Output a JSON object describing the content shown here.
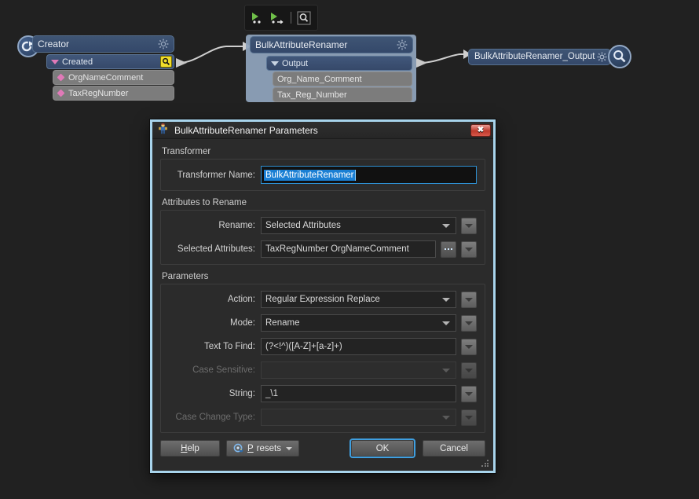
{
  "canvas": {
    "toolbar": {
      "buttons": [
        {
          "name": "run-to-this-icon",
          "label": "run-to-this"
        },
        {
          "name": "run-from-this-icon",
          "label": "run-from-this"
        },
        {
          "name": "inspect-icon",
          "label": "magnifier"
        }
      ]
    },
    "nodes": [
      {
        "id": "creator",
        "title": "Creator",
        "port": "Created",
        "attributes": [
          "OrgNameComment",
          "TaxRegNumber"
        ],
        "icon": "creator-icon",
        "gear": "gear-icon",
        "badge": "magnifier-badge"
      },
      {
        "id": "bulk_attribute_renamer",
        "title": "BulkAttributeRenamer",
        "port": "Output",
        "attributes": [
          "Org_Name_Comment",
          "Tax_Reg_Number"
        ],
        "gear": "gear-icon",
        "selected": true
      },
      {
        "id": "bulk_attribute_renamer_output",
        "title": "BulkAttributeRenamer_Output",
        "gear": "gear-icon",
        "magnifier": "magnifier-icon"
      }
    ]
  },
  "dialog": {
    "title": "BulkAttributeRenamer Parameters",
    "title_icon": "fme-workbench-icon",
    "close_label": "✖",
    "sections": [
      {
        "label": "Transformer",
        "rows": [
          {
            "label": "Transformer Name:",
            "type": "text-selected",
            "value": "BulkAttributeRenamer",
            "enabled": true
          }
        ]
      },
      {
        "label": "Attributes to Rename",
        "rows": [
          {
            "label": "Rename:",
            "type": "combo",
            "value": "Selected Attributes",
            "enabled": true,
            "sidebutton": "dropdown"
          },
          {
            "label": "Selected Attributes:",
            "type": "text",
            "value": "TaxRegNumber OrgNameComment",
            "enabled": true,
            "dotsbutton": "ellipsis",
            "sidebutton": "dropdown"
          }
        ]
      },
      {
        "label": "Parameters",
        "rows": [
          {
            "label": "Action:",
            "type": "combo",
            "value": "Regular Expression Replace",
            "enabled": true,
            "sidebutton": "dropdown"
          },
          {
            "label": "Mode:",
            "type": "combo",
            "value": "Rename",
            "enabled": true,
            "sidebutton": "dropdown"
          },
          {
            "label": "Text To Find:",
            "type": "text",
            "value": "(?<!^)([A-Z]+[a-z]+)",
            "enabled": true,
            "sidebutton": "dropdown"
          },
          {
            "label": "Case Sensitive:",
            "type": "combo",
            "value": "",
            "enabled": false,
            "sidebutton": "dropdown"
          },
          {
            "label": "String:",
            "type": "text",
            "value": "_\\1",
            "enabled": true,
            "sidebutton": "dropdown"
          },
          {
            "label": "Case Change Type:",
            "type": "combo",
            "value": "",
            "enabled": false,
            "sidebutton": "dropdown"
          }
        ]
      }
    ],
    "buttons": {
      "help": "Help",
      "help_mnemonic": "H",
      "help_rest": "elp",
      "presets": "Presets",
      "presets_mnemonic": "P",
      "presets_rest": "resets",
      "ok": "OK",
      "cancel": "Cancel"
    }
  },
  "colors": {
    "dialog_border": "#a8d4ec",
    "accent_blue": "#1a7fd4",
    "node_blue": "#3f5574",
    "attr_grey": "#7c7c7c",
    "pink_marker": "#e07ab8",
    "canvas_bg": "#212121"
  }
}
